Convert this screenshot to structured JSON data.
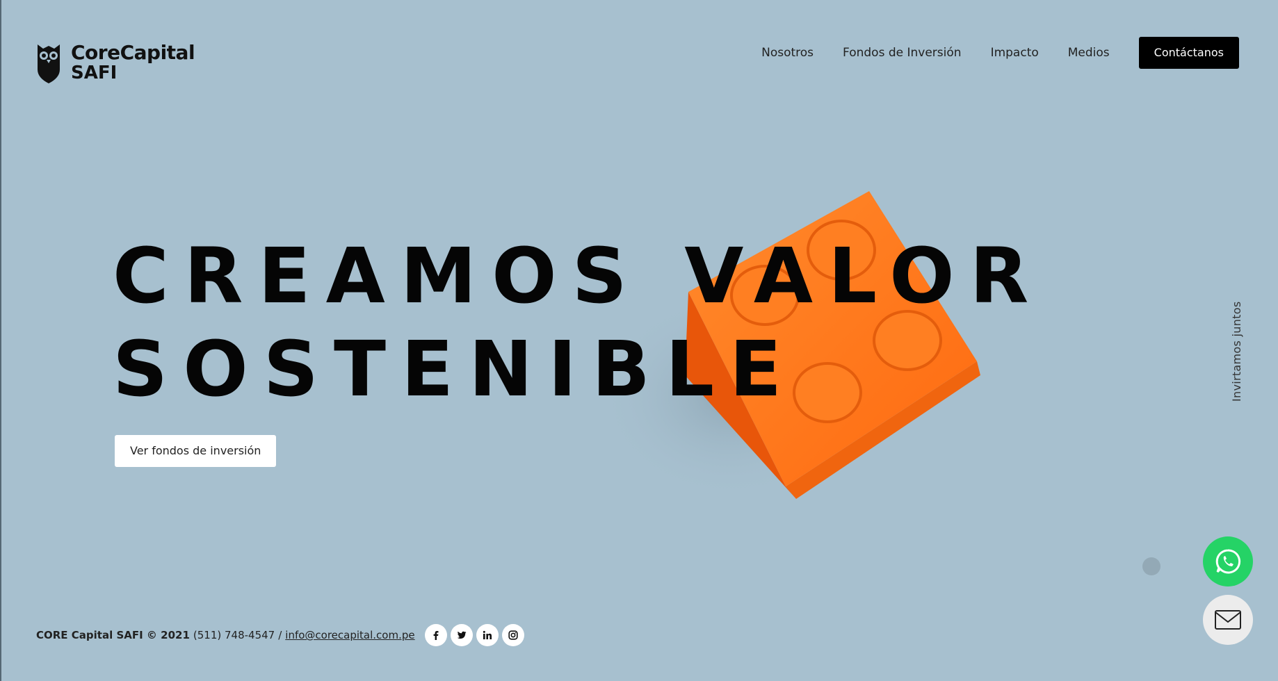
{
  "brand": {
    "name": "CoreCapital",
    "sub": "SAFI"
  },
  "nav": {
    "items": [
      "Nosotros",
      "Fondos de Inversión",
      "Impacto",
      "Medios"
    ],
    "cta": "Contáctanos"
  },
  "hero": {
    "title_line1": "CREAMOS VALOR",
    "title_line2": "SOSTENIBLE",
    "button": "Ver fondos de inversión"
  },
  "side_text": "Invirtamos juntos",
  "footer": {
    "brand": "CORE Capital SAFI © 2021",
    "phone": "(511) 748-4547",
    "separator": "/",
    "email": "info@corecapital.com.pe",
    "socials": [
      "facebook-icon",
      "twitter-icon",
      "linkedin-icon",
      "instagram-icon"
    ]
  },
  "floating": [
    "whatsapp-icon",
    "mail-icon"
  ],
  "colors": {
    "background": "#a7c0cf",
    "cta": "#000000",
    "whatsapp": "#25d366",
    "brick": "#ff7a1f"
  }
}
